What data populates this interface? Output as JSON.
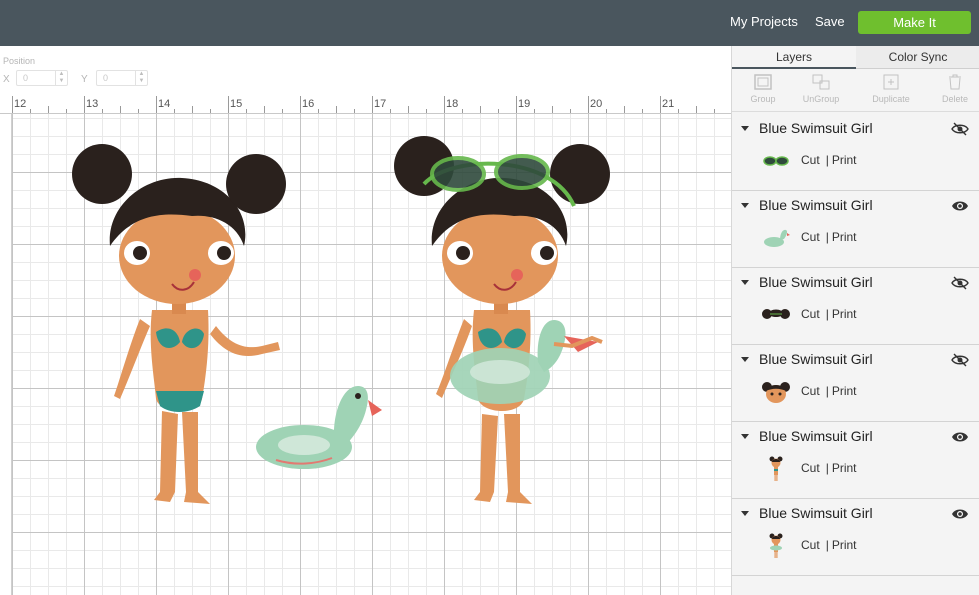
{
  "header": {
    "my_projects": "My Projects",
    "save": "Save",
    "make_it": "Make It"
  },
  "position": {
    "label": "Position",
    "x_label": "X",
    "x_value": "0",
    "y_label": "Y",
    "y_value": "0"
  },
  "ruler": {
    "numbers": [
      "12",
      "13",
      "14",
      "15",
      "16",
      "17",
      "18",
      "19",
      "20",
      "21"
    ]
  },
  "panel": {
    "tabs": [
      "Layers",
      "Color Sync"
    ],
    "tools": [
      "Group",
      "UnGroup",
      "Duplicate",
      "Delete"
    ],
    "layers": [
      {
        "name": "Blue Swimsuit Girl",
        "cut": "Cut",
        "print": "Print",
        "visible": false,
        "thumb": "goggles-icon"
      },
      {
        "name": "Blue Swimsuit Girl",
        "cut": "Cut",
        "print": "Print",
        "visible": true,
        "thumb": "duck-float-icon"
      },
      {
        "name": "Blue Swimsuit Girl",
        "cut": "Cut",
        "print": "Print",
        "visible": false,
        "thumb": "hair-icon"
      },
      {
        "name": "Blue Swimsuit Girl",
        "cut": "Cut",
        "print": "Print",
        "visible": false,
        "thumb": "face-icon"
      },
      {
        "name": "Blue Swimsuit Girl",
        "cut": "Cut",
        "print": "Print",
        "visible": true,
        "thumb": "girl-icon"
      },
      {
        "name": "Blue Swimsuit Girl",
        "cut": "Cut",
        "print": "Print",
        "visible": true,
        "thumb": "girl-float-icon"
      }
    ]
  },
  "colors": {
    "topbar": "#4a565e",
    "make_it": "#6fbf2e",
    "skin": "#e2965c",
    "hair": "#2a211d",
    "swimsuit": "#2f9489",
    "float": "#9fd3b5",
    "goggles": "#66b84c"
  }
}
